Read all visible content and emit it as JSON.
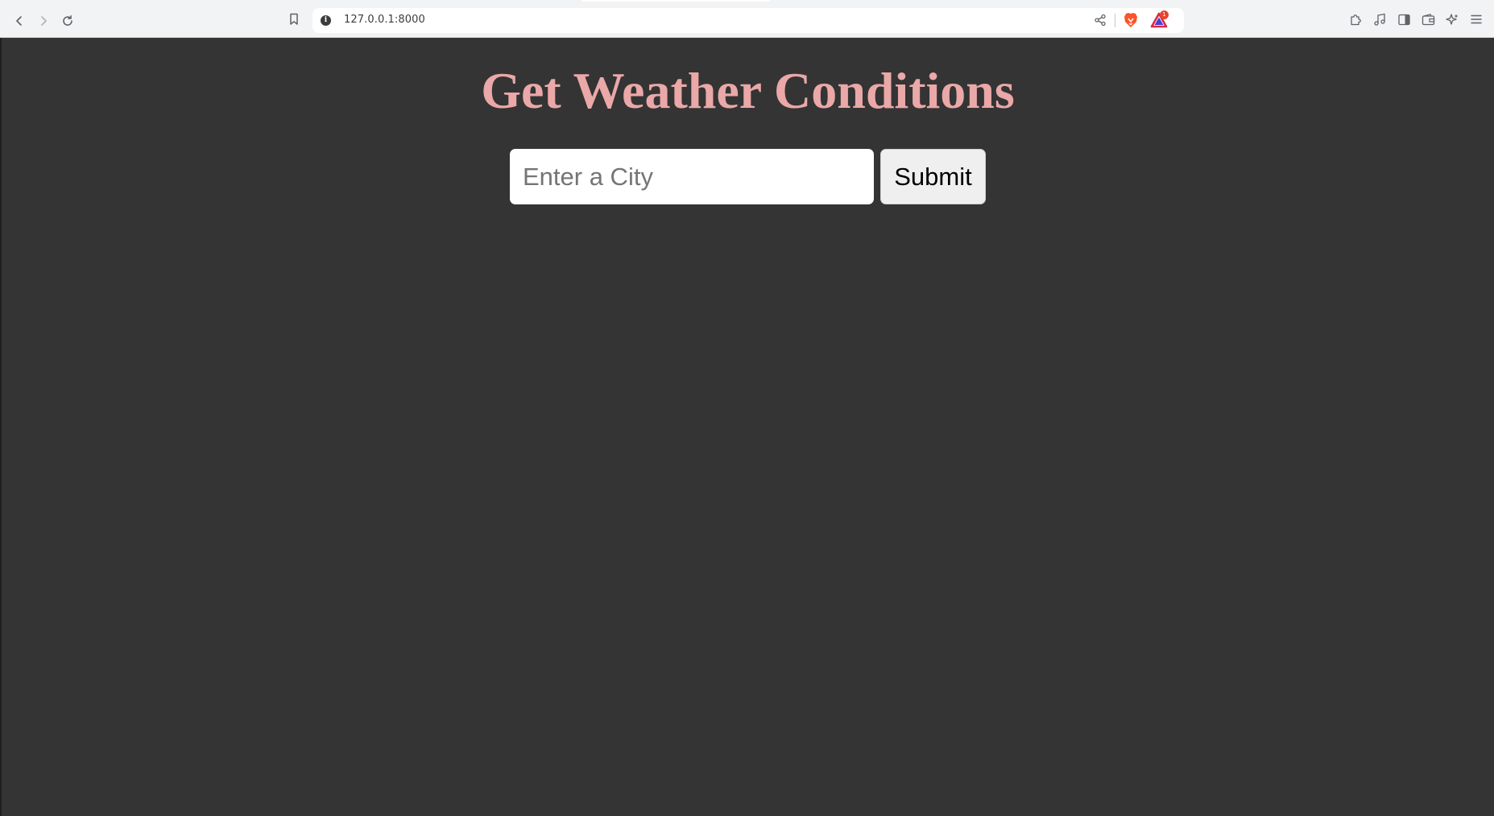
{
  "browser": {
    "url": "127.0.0.1:8000",
    "rewards_badge_count": "1",
    "icons": {
      "back": "chevron-left-icon",
      "forward": "chevron-right-icon",
      "reload": "reload-icon",
      "bookmark": "bookmark-icon",
      "site_info": "info-icon",
      "share": "share-icon",
      "brave_shields": "brave-lion-icon",
      "brave_rewards": "rewards-triangle-icon",
      "extensions": "puzzle-icon",
      "media": "music-note-icon",
      "sidebar": "sidebar-icon",
      "wallet": "wallet-icon",
      "leo": "sparkle-icon",
      "menu": "hamburger-icon"
    }
  },
  "page": {
    "title": "Get Weather Conditions",
    "city_input": {
      "placeholder": "Enter a City",
      "value": ""
    },
    "submit_label": "Submit"
  },
  "colors": {
    "background": "#343434",
    "title": "#eaa8a8",
    "input_bg": "#ffffff",
    "button_bg": "#efefef"
  }
}
